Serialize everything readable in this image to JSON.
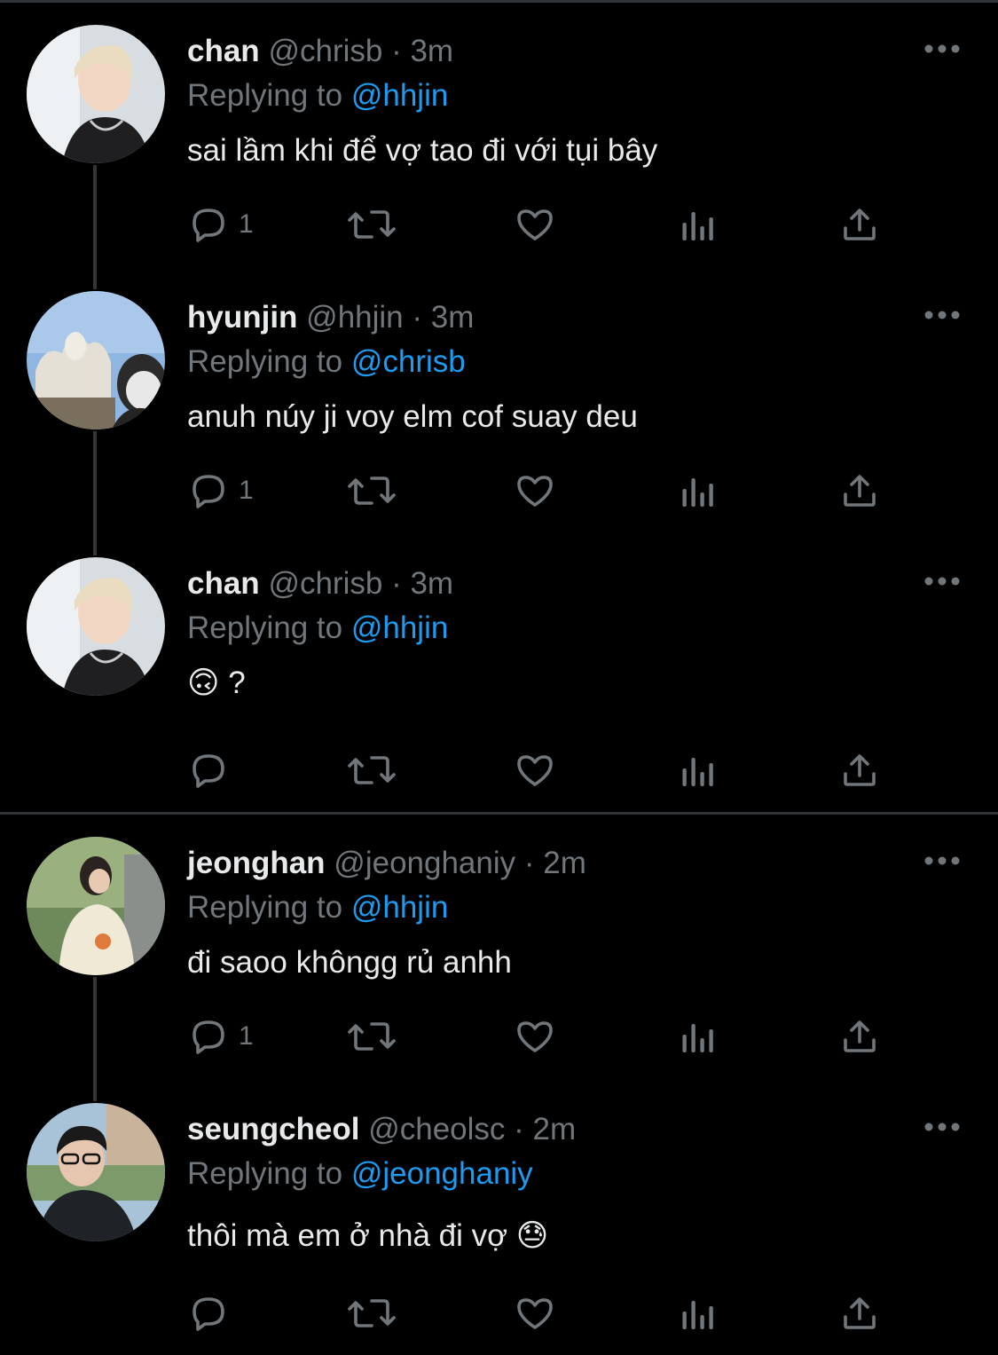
{
  "tweets": [
    {
      "name": "chan",
      "handle": "@chrisb",
      "time": "3m",
      "reply_prefix": "Replying to",
      "reply_to": "@hhjin",
      "text": "sai lầm khi để vợ tao đi với tụi bây",
      "reply_count": "1"
    },
    {
      "name": "hyunjin",
      "handle": "@hhjin",
      "time": "3m",
      "reply_prefix": "Replying to",
      "reply_to": "@chrisb",
      "text": "anuh núy ji voy elm cof suay deu",
      "reply_count": "1"
    },
    {
      "name": "chan",
      "handle": "@chrisb",
      "time": "3m",
      "reply_prefix": "Replying to",
      "reply_to": "@hhjin",
      "text": "🙃 ?",
      "reply_count": ""
    },
    {
      "name": "jeonghan",
      "handle": "@jeonghaniy",
      "time": "2m",
      "reply_prefix": "Replying to",
      "reply_to": "@hhjin",
      "text": "đi saoo khôngg rủ anhh",
      "reply_count": "1"
    },
    {
      "name": "seungcheol",
      "handle": "@cheolsc",
      "time": "2m",
      "reply_prefix": "Replying to",
      "reply_to": "@jeonghaniy",
      "text": "thôi mà em ở nhà đi vợ 😓",
      "reply_count": ""
    }
  ],
  "separator_char": "·",
  "colors": {
    "background": "#000000",
    "text": "#e7e9ea",
    "muted": "#71767b",
    "link": "#1d9bf0",
    "line": "#333639"
  },
  "icons": [
    "reply-icon",
    "retweet-icon",
    "like-icon",
    "analytics-icon",
    "share-icon",
    "more-icon"
  ]
}
